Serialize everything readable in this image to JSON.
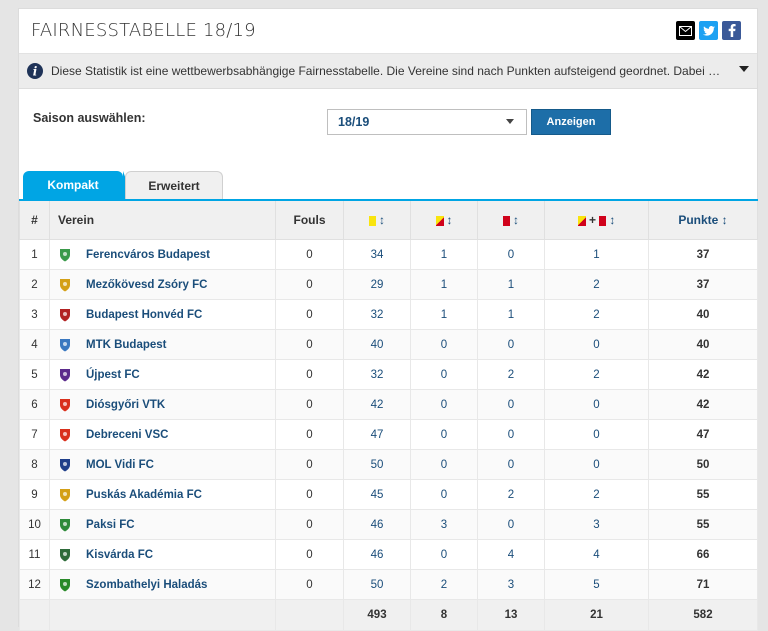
{
  "title": "FAIRNESSTABELLE 18/19",
  "social": {
    "email_icon": "email-icon",
    "twitter_icon": "twitter-icon",
    "facebook_icon": "facebook-icon",
    "colors": {
      "twitter": "#1da1f2",
      "facebook": "#3b5998",
      "email": "#000000"
    }
  },
  "info_text": "Diese Statistik ist eine wettbewerbsabhängige Fairnesstabelle. Die Vereine sind nach Punkten aufsteigend geordnet. Dabei zählt eine Gelbe Ka...",
  "season": {
    "label": "Saison auswählen:",
    "selected": "18/19",
    "button": "Anzeigen"
  },
  "tabs": {
    "active": "Kompakt",
    "inactive": "Erweitert"
  },
  "accent_color": "#00a5e4",
  "columns": {
    "num": "#",
    "club": "Verein",
    "fouls": "Fouls",
    "yellow": "↕",
    "yellowred": "↕",
    "red": "↕",
    "combo_plus": "+",
    "combo": "↕",
    "points": "Punkte ↕"
  },
  "rows": [
    {
      "rank": "1",
      "club": "Ferencváros Budapest",
      "fouls": "0",
      "yellow": "34",
      "yr": "1",
      "red": "0",
      "yrr": "1",
      "pts": "37"
    },
    {
      "rank": "2",
      "club": "Mezőkövesd Zsóry FC",
      "fouls": "0",
      "yellow": "29",
      "yr": "1",
      "red": "1",
      "yrr": "2",
      "pts": "37"
    },
    {
      "rank": "3",
      "club": "Budapest Honvéd FC",
      "fouls": "0",
      "yellow": "32",
      "yr": "1",
      "red": "1",
      "yrr": "2",
      "pts": "40"
    },
    {
      "rank": "4",
      "club": "MTK Budapest",
      "fouls": "0",
      "yellow": "40",
      "yr": "0",
      "red": "0",
      "yrr": "0",
      "pts": "40"
    },
    {
      "rank": "5",
      "club": "Újpest FC",
      "fouls": "0",
      "yellow": "32",
      "yr": "0",
      "red": "2",
      "yrr": "2",
      "pts": "42"
    },
    {
      "rank": "6",
      "club": "Diósgyőri VTK",
      "fouls": "0",
      "yellow": "42",
      "yr": "0",
      "red": "0",
      "yrr": "0",
      "pts": "42"
    },
    {
      "rank": "7",
      "club": "Debreceni VSC",
      "fouls": "0",
      "yellow": "47",
      "yr": "0",
      "red": "0",
      "yrr": "0",
      "pts": "47"
    },
    {
      "rank": "8",
      "club": "MOL Vidi FC",
      "fouls": "0",
      "yellow": "50",
      "yr": "0",
      "red": "0",
      "yrr": "0",
      "pts": "50"
    },
    {
      "rank": "9",
      "club": "Puskás Akadémia FC",
      "fouls": "0",
      "yellow": "45",
      "yr": "0",
      "red": "2",
      "yrr": "2",
      "pts": "55"
    },
    {
      "rank": "10",
      "club": "Paksi FC",
      "fouls": "0",
      "yellow": "46",
      "yr": "3",
      "red": "0",
      "yrr": "3",
      "pts": "55"
    },
    {
      "rank": "11",
      "club": "Kisvárda FC",
      "fouls": "0",
      "yellow": "46",
      "yr": "0",
      "red": "4",
      "yrr": "4",
      "pts": "66"
    },
    {
      "rank": "12",
      "club": "Szombathelyi Haladás",
      "fouls": "0",
      "yellow": "50",
      "yr": "2",
      "red": "3",
      "yrr": "5",
      "pts": "71"
    }
  ],
  "crest_colors": [
    "#3a9a4a",
    "#d4a017",
    "#b22222",
    "#3a78c0",
    "#5b2b8c",
    "#d9301c",
    "#d9301c",
    "#1f3f8a",
    "#d4a017",
    "#2e8b3a",
    "#2e6b3a",
    "#2a8a2a"
  ],
  "totals": {
    "fouls": "",
    "yellow": "493",
    "yr": "8",
    "red": "13",
    "yrr": "21",
    "pts": "582"
  }
}
